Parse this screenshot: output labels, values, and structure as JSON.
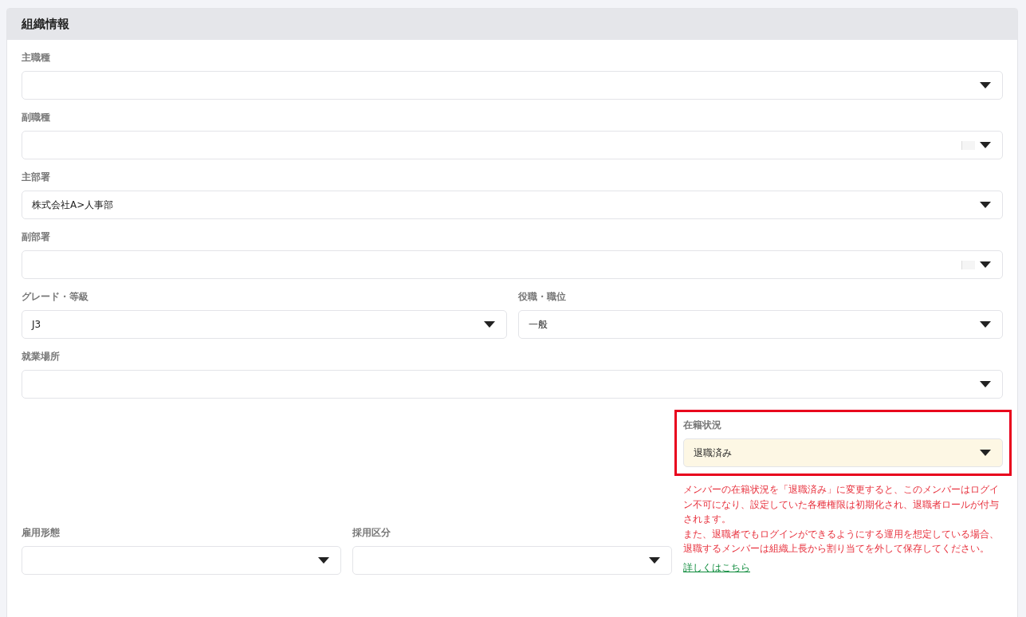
{
  "section": {
    "title": "組織情報"
  },
  "rows": [
    {
      "fields": [
        {
          "label": "主職種"
        }
      ]
    },
    {
      "fields": [
        {
          "label": "副職種",
          "clear_box": true
        }
      ]
    },
    {
      "fields": [
        {
          "label": "主部署",
          "value": "株式会社A>人事部"
        }
      ]
    },
    {
      "fields": [
        {
          "label": "副部署",
          "clear_box": true
        }
      ]
    },
    {
      "fields": [
        {
          "label": "グレード・等級",
          "value": "J3"
        },
        {
          "label": "役職・職位",
          "value": "一般"
        }
      ]
    },
    {
      "fields": [
        {
          "label": "就業場所"
        }
      ]
    }
  ],
  "bottom_fields": [
    {
      "label": "雇用形態"
    },
    {
      "label": "採用区分"
    }
  ],
  "status": {
    "label": "在籍状況",
    "value": "退職済み",
    "highlighted": true,
    "notes": [
      "メンバーの在籍状況を「退職済み」に変更すると、このメンバーはログイン不可になり、設定していた各種権限は初期化され、退職者ロールが付与されます。",
      "また、退職者でもログインができるようにする運用を想定している場合、退職するメンバーは組織上長から割り当てを外して保存してください。"
    ],
    "link": "詳しくはこちら"
  }
}
